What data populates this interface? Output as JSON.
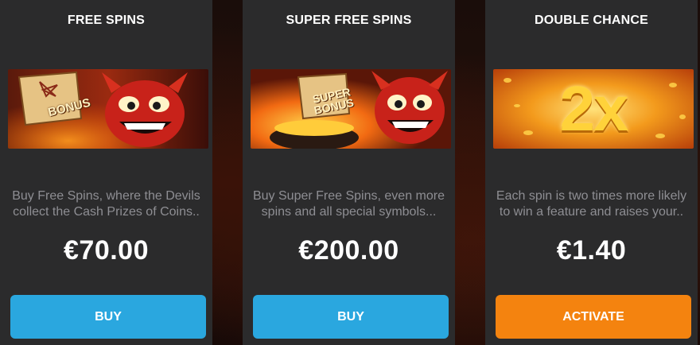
{
  "cards": [
    {
      "title": "FREE SPINS",
      "banner_text": "BONUS",
      "desc_line1": "Buy Free Spins, where the Devils",
      "desc_line2": "collect the Cash Prizes of Coins..",
      "price": "€70.00",
      "button_label": "BUY",
      "button_color": "#2aa7df"
    },
    {
      "title": "SUPER FREE SPINS",
      "banner_text_line1": "SUPER",
      "banner_text_line2": "BONUS",
      "desc_line1": "Buy Super Free Spins, even more",
      "desc_line2": "spins and all special symbols...",
      "price": "€200.00",
      "button_label": "BUY",
      "button_color": "#2aa7df"
    },
    {
      "title": "DOUBLE CHANCE",
      "banner_text": "2x",
      "desc_line1": "Each spin is two times more likely",
      "desc_line2": "to win a feature and raises your..",
      "price": "€1.40",
      "button_label": "ACTIVATE",
      "button_color": "#f4830f"
    }
  ],
  "colors": {
    "card_background": "#2b2b2c",
    "description_text": "#8e8e93",
    "page_background": "#160a08"
  }
}
